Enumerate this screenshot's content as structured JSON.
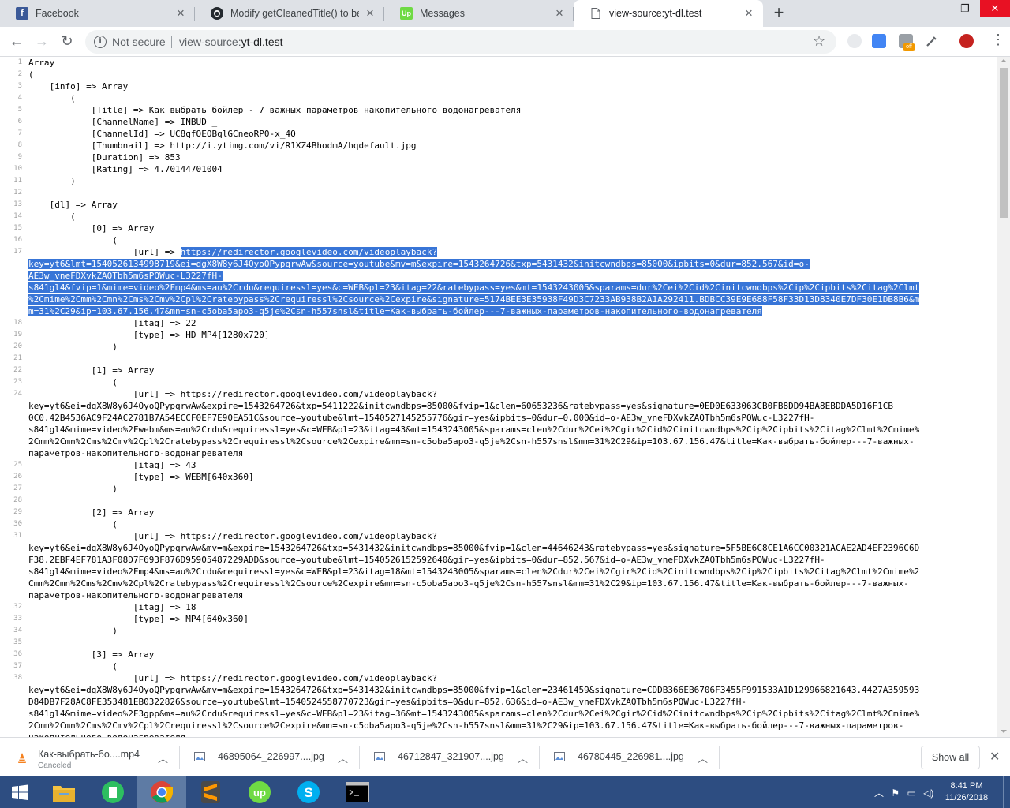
{
  "tabs": [
    {
      "title": "Facebook",
      "icon": "facebook-icon",
      "color": "#3b5998",
      "active": false
    },
    {
      "title": "Modify getCleanedTitle() to bette",
      "icon": "github-icon",
      "color": "#24292e",
      "active": false
    },
    {
      "title": "Messages",
      "icon": "upwork-icon",
      "color": "#6fda44",
      "active": false
    },
    {
      "title": "view-source:yt-dl.test",
      "icon": "page-icon",
      "color": "#5f6368",
      "active": true
    }
  ],
  "toolbar": {
    "not_secure": "Not secure",
    "url_prefix": "view-source:",
    "url_host": "yt-dl.test"
  },
  "selection_color": "#3875d7",
  "source": [
    {
      "n": "1",
      "t": "Array"
    },
    {
      "n": "2",
      "t": "("
    },
    {
      "n": "3",
      "t": "    [info] => Array"
    },
    {
      "n": "4",
      "t": "        ("
    },
    {
      "n": "5",
      "t": "            [Title] => Как выбрать бойлер - 7 важных параметров накопительного водонагревателя"
    },
    {
      "n": "6",
      "t": "            [ChannelName] => INBUD _"
    },
    {
      "n": "7",
      "t": "            [ChannelId] => UC8qfOEOBqlGCneoRP0-x_4Q"
    },
    {
      "n": "8",
      "t": "            [Thumbnail] => http://i.ytimg.com/vi/R1XZ4BhodmA/hqdefault.jpg"
    },
    {
      "n": "9",
      "t": "            [Duration] => 853"
    },
    {
      "n": "10",
      "t": "            [Rating] => 4.70144701004"
    },
    {
      "n": "11",
      "t": "        )"
    },
    {
      "n": "12",
      "t": ""
    },
    {
      "n": "13",
      "t": "    [dl] => Array"
    },
    {
      "n": "14",
      "t": "        ("
    },
    {
      "n": "15",
      "t": "            [0] => Array"
    },
    {
      "n": "16",
      "t": "                ("
    },
    {
      "n": "17",
      "t": "                    [url] => ",
      "sel": "https://redirector.googlevideo.com/videoplayback?"
    },
    {
      "n": "",
      "t": "",
      "sel": "key=yt6&lmt=1540526134998719&ei=dgX8W8y6J4OyoQPypqrwAw&source=youtube&mv=m&expire=1543264726&txp=5431432&initcwndbps=85000&ipbits=0&dur=852.567&id=o-"
    },
    {
      "n": "",
      "t": "",
      "sel": "AE3w_vneFDXvkZAQTbh5m6sPQWuc-L3227fH-"
    },
    {
      "n": "",
      "t": "",
      "sel": "s841gl4&fvip=1&mime=video%2Fmp4&ms=au%2Crdu&requiressl=yes&c=WEB&pl=23&itag=22&ratebypass=yes&mt=1543243005&sparams=dur%2Cei%2Cid%2Cinitcwndbps%2Cip%2Cipbits%2Citag%2Clmt"
    },
    {
      "n": "",
      "t": "",
      "sel": "%2Cmime%2Cmm%2Cmn%2Cms%2Cmv%2Cpl%2Cratebypass%2Crequiressl%2Csource%2Cexpire&signature=5174BEE3E35938F49D3C7233AB938B2A1A292411.BDBCC39E9E688F58F33D13D8340E7DF30E1DB8B6&m"
    },
    {
      "n": "",
      "t": "",
      "sel": "m=31%2C29&ip=103.67.156.47&mn=sn-c5oba5apo3-q5je%2Csn-h557snsl&title=Как-выбрать-бойлер---7-важных-параметров-накопительного-водонагревателя"
    },
    {
      "n": "18",
      "t": "                    [itag] => 22"
    },
    {
      "n": "19",
      "t": "                    [type] => HD MP4[1280x720]"
    },
    {
      "n": "20",
      "t": "                )"
    },
    {
      "n": "21",
      "t": ""
    },
    {
      "n": "22",
      "t": "            [1] => Array"
    },
    {
      "n": "23",
      "t": "                ("
    },
    {
      "n": "24",
      "t": "                    [url] => https://redirector.googlevideo.com/videoplayback?"
    },
    {
      "n": "",
      "t": "key=yt6&ei=dgX8W8y6J4OyoQPypqrwAw&expire=1543264726&txp=5411222&initcwndbps=85000&fvip=1&clen=60653236&ratebypass=yes&signature=0ED0E633063CB0FB8DD94BA8EBDDA5D16F1CB"
    },
    {
      "n": "",
      "t": "0C0.42B4536AC9F24AC2781B7A54ECCF0EF7E90EA51C&source=youtube&lmt=1540527145255776&gir=yes&ipbits=0&dur=0.000&id=o-AE3w_vneFDXvkZAQTbh5m6sPQWuc-L3227fH-"
    },
    {
      "n": "",
      "t": "s841gl4&mime=video%2Fwebm&ms=au%2Crdu&requiressl=yes&c=WEB&pl=23&itag=43&mt=1543243005&sparams=clen%2Cdur%2Cei%2Cgir%2Cid%2Cinitcwndbps%2Cip%2Cipbits%2Citag%2Clmt%2Cmime%"
    },
    {
      "n": "",
      "t": "2Cmm%2Cmn%2Cms%2Cmv%2Cpl%2Cratebypass%2Crequiressl%2Csource%2Cexpire&mn=sn-c5oba5apo3-q5je%2Csn-h557snsl&mm=31%2C29&ip=103.67.156.47&title=Как-выбрать-бойлер---7-важных-"
    },
    {
      "n": "",
      "t": "параметров-накопительного-водонагревателя"
    },
    {
      "n": "25",
      "t": "                    [itag] => 43"
    },
    {
      "n": "26",
      "t": "                    [type] => WEBM[640x360]"
    },
    {
      "n": "27",
      "t": "                )"
    },
    {
      "n": "28",
      "t": ""
    },
    {
      "n": "29",
      "t": "            [2] => Array"
    },
    {
      "n": "30",
      "t": "                ("
    },
    {
      "n": "31",
      "t": "                    [url] => https://redirector.googlevideo.com/videoplayback?"
    },
    {
      "n": "",
      "t": "key=yt6&ei=dgX8W8y6J4OyoQPypqrwAw&mv=m&expire=1543264726&txp=5431432&initcwndbps=85000&fvip=1&clen=44646243&ratebypass=yes&signature=5F5BE6C8CE1A6CC00321ACAE2AD4EF2396C6D"
    },
    {
      "n": "",
      "t": "F38.2EBF4EF781A3F08D7F693F876D95905487229ADD&source=youtube&lmt=1540526152592640&gir=yes&ipbits=0&dur=852.567&id=o-AE3w_vneFDXvkZAQTbh5m6sPQWuc-L3227fH-"
    },
    {
      "n": "",
      "t": "s841gl4&mime=video%2Fmp4&ms=au%2Crdu&requiressl=yes&c=WEB&pl=23&itag=18&mt=1543243005&sparams=clen%2Cdur%2Cei%2Cgir%2Cid%2Cinitcwndbps%2Cip%2Cipbits%2Citag%2Clmt%2Cmime%2"
    },
    {
      "n": "",
      "t": "Cmm%2Cmn%2Cms%2Cmv%2Cpl%2Cratebypass%2Crequiressl%2Csource%2Cexpire&mn=sn-c5oba5apo3-q5je%2Csn-h557snsl&mm=31%2C29&ip=103.67.156.47&title=Как-выбрать-бойлер---7-важных-"
    },
    {
      "n": "",
      "t": "параметров-накопительного-водонагревателя"
    },
    {
      "n": "32",
      "t": "                    [itag] => 18"
    },
    {
      "n": "33",
      "t": "                    [type] => MP4[640x360]"
    },
    {
      "n": "34",
      "t": "                )"
    },
    {
      "n": "35",
      "t": ""
    },
    {
      "n": "36",
      "t": "            [3] => Array"
    },
    {
      "n": "37",
      "t": "                ("
    },
    {
      "n": "38",
      "t": "                    [url] => https://redirector.googlevideo.com/videoplayback?"
    },
    {
      "n": "",
      "t": "key=yt6&ei=dgX8W8y6J4OyoQPypqrwAw&mv=m&expire=1543264726&txp=5431432&initcwndbps=85000&fvip=1&clen=23461459&signature=CDDB366EB6706F3455F991533A1D129966821643.4427A359593"
    },
    {
      "n": "",
      "t": "D84DB7F28AC8FE353481EB0322826&source=youtube&lmt=1540524558770723&gir=yes&ipbits=0&dur=852.636&id=o-AE3w_vneFDXvkZAQTbh5m6sPQWuc-L3227fH-"
    },
    {
      "n": "",
      "t": "s841gl4&mime=video%2F3gpp&ms=au%2Crdu&requiressl=yes&c=WEB&pl=23&itag=36&mt=1543243005&sparams=clen%2Cdur%2Cei%2Cgir%2Cid%2Cinitcwndbps%2Cip%2Cipbits%2Citag%2Clmt%2Cmime%"
    },
    {
      "n": "",
      "t": "2Cmm%2Cmn%2Cms%2Cmv%2Cpl%2Crequiressl%2Csource%2Cexpire&mn=sn-c5oba5apo3-q5je%2Csn-h557snsl&mm=31%2C29&ip=103.67.156.47&title=Как-выбрать-бойлер---7-важных-параметров-"
    },
    {
      "n": "",
      "t": "накопительного-водонагревателя"
    }
  ],
  "downloads": [
    {
      "name": "Как-выбрать-бо....mp4",
      "status": "Canceled",
      "icon": "vlc-file-icon"
    },
    {
      "name": "46895064_226997....jpg",
      "status": "",
      "icon": "image-file-icon"
    },
    {
      "name": "46712847_321907....jpg",
      "status": "",
      "icon": "image-file-icon"
    },
    {
      "name": "46780445_226981....jpg",
      "status": "",
      "icon": "image-file-icon"
    }
  ],
  "shelf": {
    "show_all": "Show all"
  },
  "taskbar": {
    "apps": [
      "start-icon",
      "file-explorer-icon",
      "evernote-icon",
      "chrome-icon",
      "sublime-text-icon",
      "upwork-app-icon",
      "skype-icon",
      "terminal-icon"
    ],
    "time": "8:41 PM",
    "date": "11/26/2018",
    "color": "#2d4d81"
  }
}
